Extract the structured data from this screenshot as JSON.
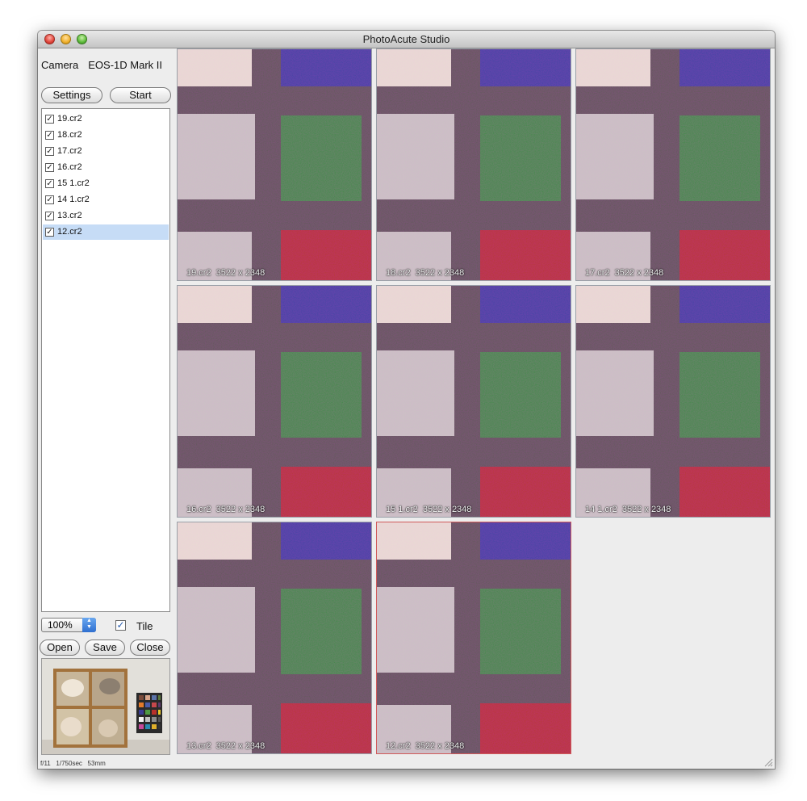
{
  "window": {
    "title": "PhotoAcute Studio"
  },
  "sidebar": {
    "camera_label": "Camera",
    "camera_value": "EOS-1D Mark II",
    "settings_label": "Settings",
    "start_label": "Start",
    "files": [
      {
        "label": "19.cr2",
        "checked": true,
        "selected": false
      },
      {
        "label": "18.cr2",
        "checked": true,
        "selected": false
      },
      {
        "label": "17.cr2",
        "checked": true,
        "selected": false
      },
      {
        "label": "16.cr2",
        "checked": true,
        "selected": false
      },
      {
        "label": "15 1.cr2",
        "checked": true,
        "selected": false
      },
      {
        "label": "14 1.cr2",
        "checked": true,
        "selected": false
      },
      {
        "label": "13.cr2",
        "checked": true,
        "selected": false
      },
      {
        "label": "12.cr2",
        "checked": true,
        "selected": true
      }
    ],
    "zoom_value": "100%",
    "tile_label": "Tile",
    "tile_checked": true,
    "open_label": "Open",
    "save_label": "Save",
    "close_label": "Close",
    "status_text": "f/11   1/750sec   53mm"
  },
  "tiles": [
    {
      "caption": "19.cr2  3522 x 2348",
      "active": false
    },
    {
      "caption": "18.cr2  3522 x 2348",
      "active": false
    },
    {
      "caption": "17.cr2  3522 x 2348",
      "active": false
    },
    {
      "caption": "16.cr2  3522 x 2348",
      "active": false
    },
    {
      "caption": "15 1.cr2  3522 x 2348",
      "active": false
    },
    {
      "caption": "14 1.cr2  3522 x 2348",
      "active": false
    },
    {
      "caption": "13.cr2  3522 x 2348",
      "active": false
    },
    {
      "caption": "12.cr2  3522 x 2348",
      "active": true
    }
  ],
  "colors": {
    "blue_patch": "#3c46a2",
    "green_patch": "#3f8a45",
    "red_patch": "#b6382a",
    "white_patch": "#e8dcd2",
    "gray_patch": "#c9c3c2",
    "dark_grid": "#5f5a57"
  }
}
